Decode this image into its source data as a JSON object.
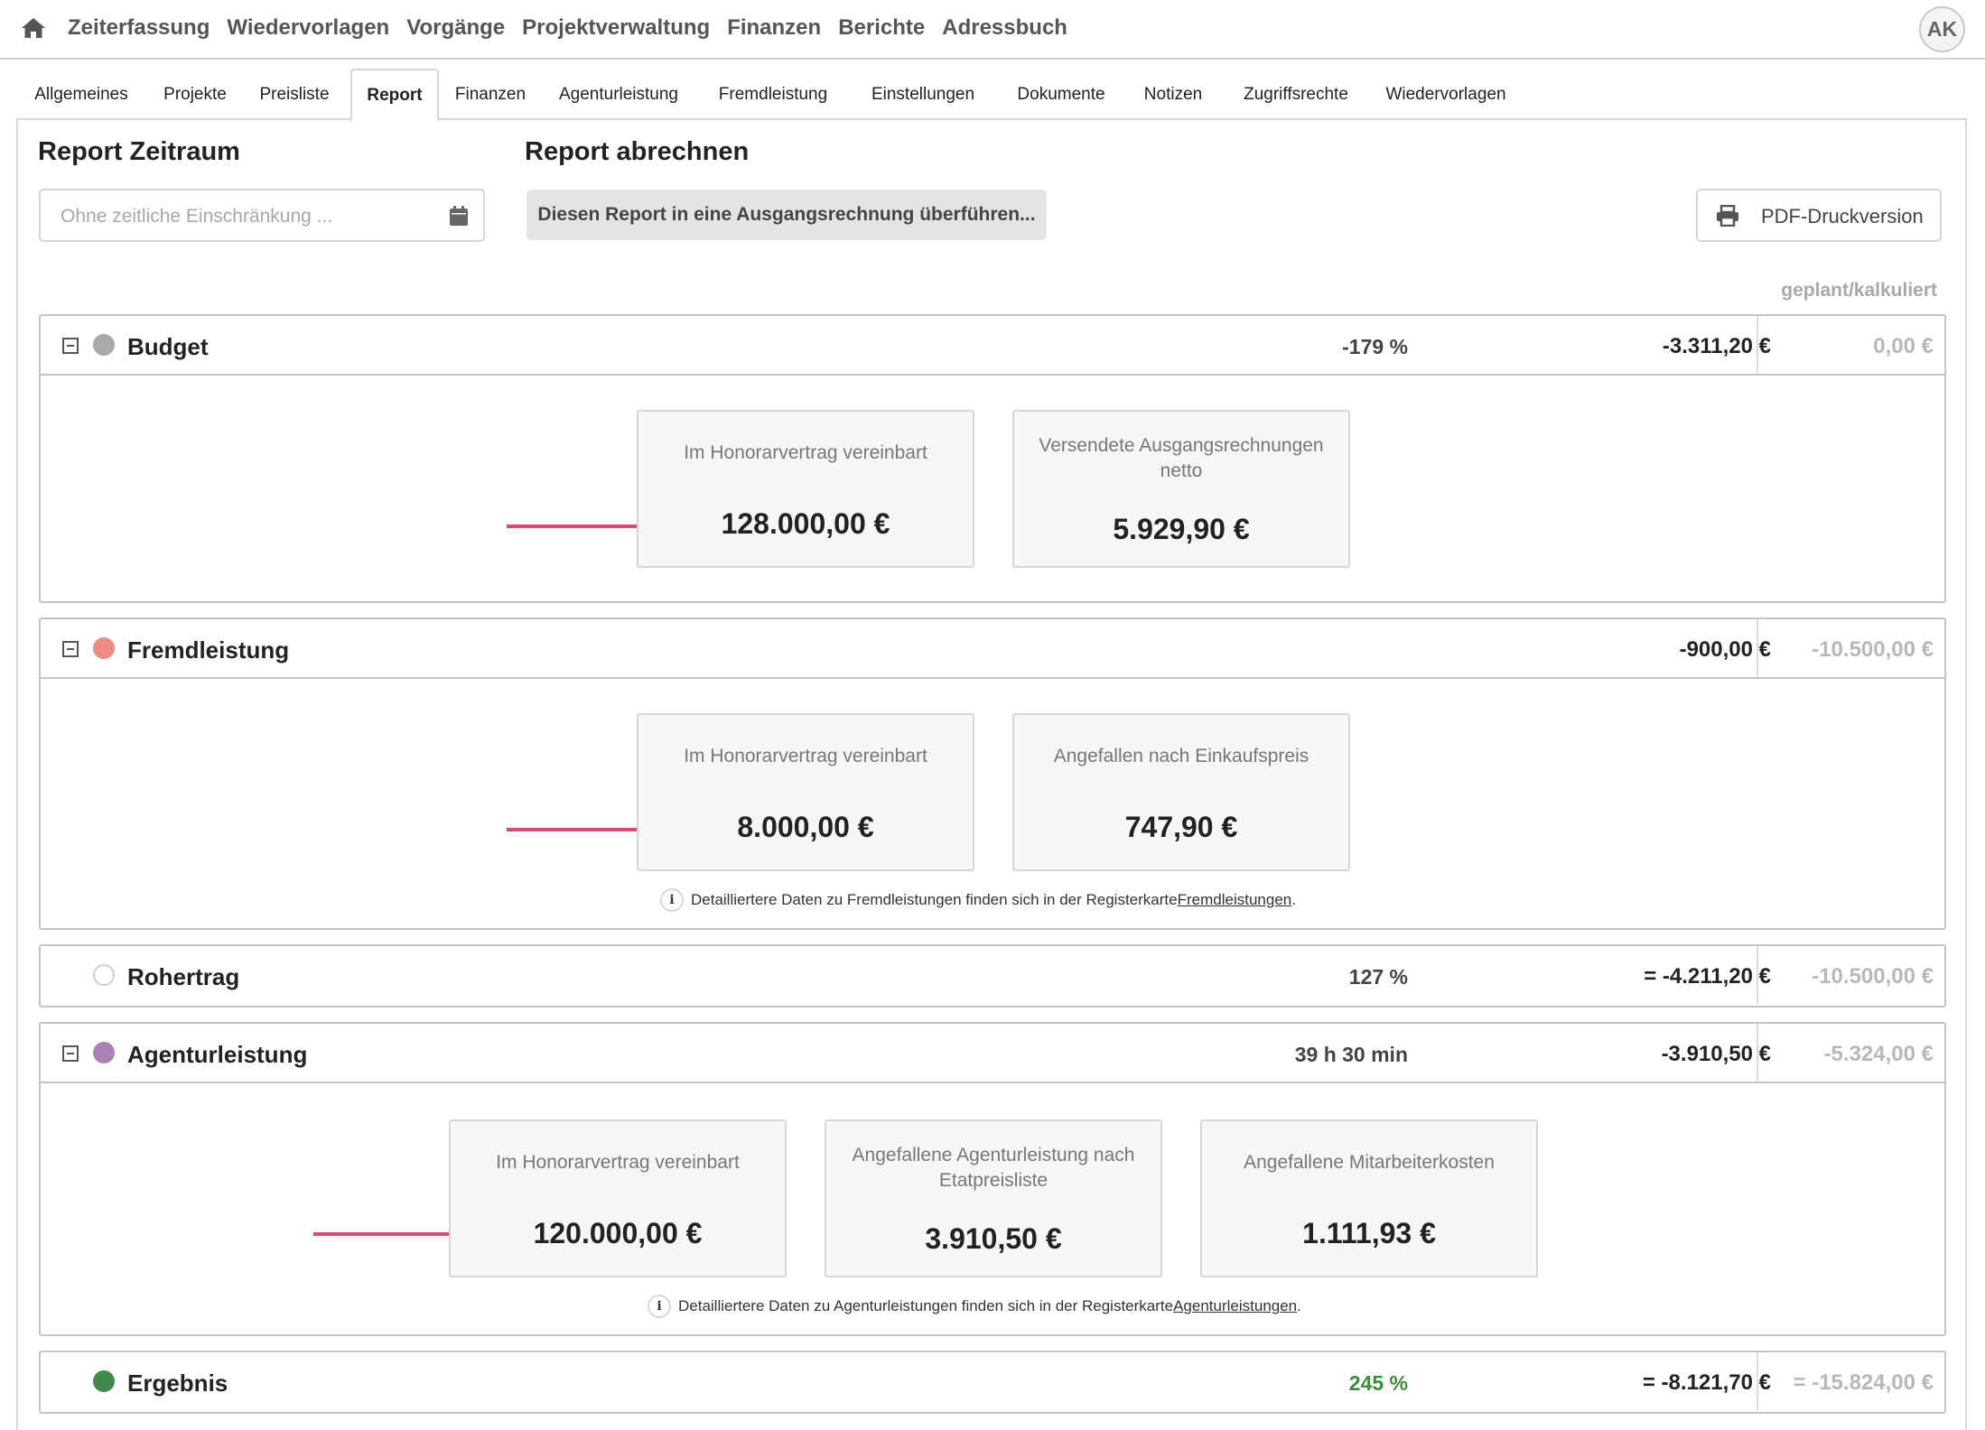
{
  "nav": {
    "items": [
      "Zeiterfassung",
      "Wiedervorlagen",
      "Vorgänge",
      "Projektverwaltung",
      "Finanzen",
      "Berichte",
      "Adressbuch"
    ],
    "avatar": "AK"
  },
  "tabs": [
    "Allgemeines",
    "Projekte",
    "Preisliste",
    "Report",
    "Finanzen",
    "Agenturleistung",
    "Fremdleistung",
    "Einstellungen",
    "Dokumente",
    "Notizen",
    "Zugriffsrechte",
    "Wiedervorlagen"
  ],
  "active_tab": "Report",
  "report_period": {
    "title": "Report Zeitraum",
    "placeholder": "Ohne zeitliche Einschränkung ..."
  },
  "report_bill": {
    "title": "Report abrechnen",
    "button": "Diesen Report in eine Ausgangsrechnung überführen..."
  },
  "pdf_button": "PDF-Druckversion",
  "column_header": "geplant/kalkuliert",
  "sections": {
    "budget": {
      "title": "Budget",
      "dot_color": "#aaaaaa",
      "middle": "-179 %",
      "value": "-3.311,20 €",
      "planned": "0,00 €",
      "cards": [
        {
          "label": "Im Honorarvertrag vereinbart",
          "value": "128.000,00 €"
        },
        {
          "label": "Versendete Ausgangsrechnungen netto",
          "value": "5.929,90 €"
        }
      ]
    },
    "fremdleistung": {
      "title": "Fremdleistung",
      "dot_color": "#ef8b84",
      "middle": "",
      "value": "-900,00 €",
      "planned": "-10.500,00 €",
      "cards": [
        {
          "label": "Im Honorarvertrag vereinbart",
          "value": "8.000,00 €"
        },
        {
          "label": "Angefallen nach Einkaufspreis",
          "value": "747,90 €"
        }
      ],
      "note": {
        "text": "Detailliertere Daten zu Fremdleistungen finden sich in der Registerkarte ",
        "link": "Fremdleistungen",
        "end": "."
      }
    },
    "rohertrag": {
      "title": "Rohertrag",
      "dot_color": "#ffffff",
      "middle": "127 %",
      "value": "= -4.211,20 €",
      "planned": "-10.500,00 €"
    },
    "agenturleistung": {
      "title": "Agenturleistung",
      "dot_color": "#a983b8",
      "middle": "39 h 30 min",
      "value": "-3.910,50 €",
      "planned": "-5.324,00 €",
      "cards": [
        {
          "label": "Im Honorarvertrag vereinbart",
          "value": "120.000,00 €"
        },
        {
          "label": "Angefallene Agenturleistung nach Etatpreisliste",
          "value": "3.910,50 €"
        },
        {
          "label": "Angefallene Mitarbeiterkosten",
          "value": "1.111,93 €"
        }
      ],
      "note": {
        "text": "Detailliertere Daten zu Agenturleistungen finden sich in der Registerkarte ",
        "link": "Agenturleistungen",
        "end": "."
      }
    },
    "ergebnis": {
      "title": "Ergebnis",
      "dot_color": "#3f8a4a",
      "middle": "245 %",
      "middle_color": "#3f8a3f",
      "value": "= -8.121,70 €",
      "planned": "= -15.824,00 €"
    }
  },
  "colors": {
    "arrow": "#d9467a"
  }
}
